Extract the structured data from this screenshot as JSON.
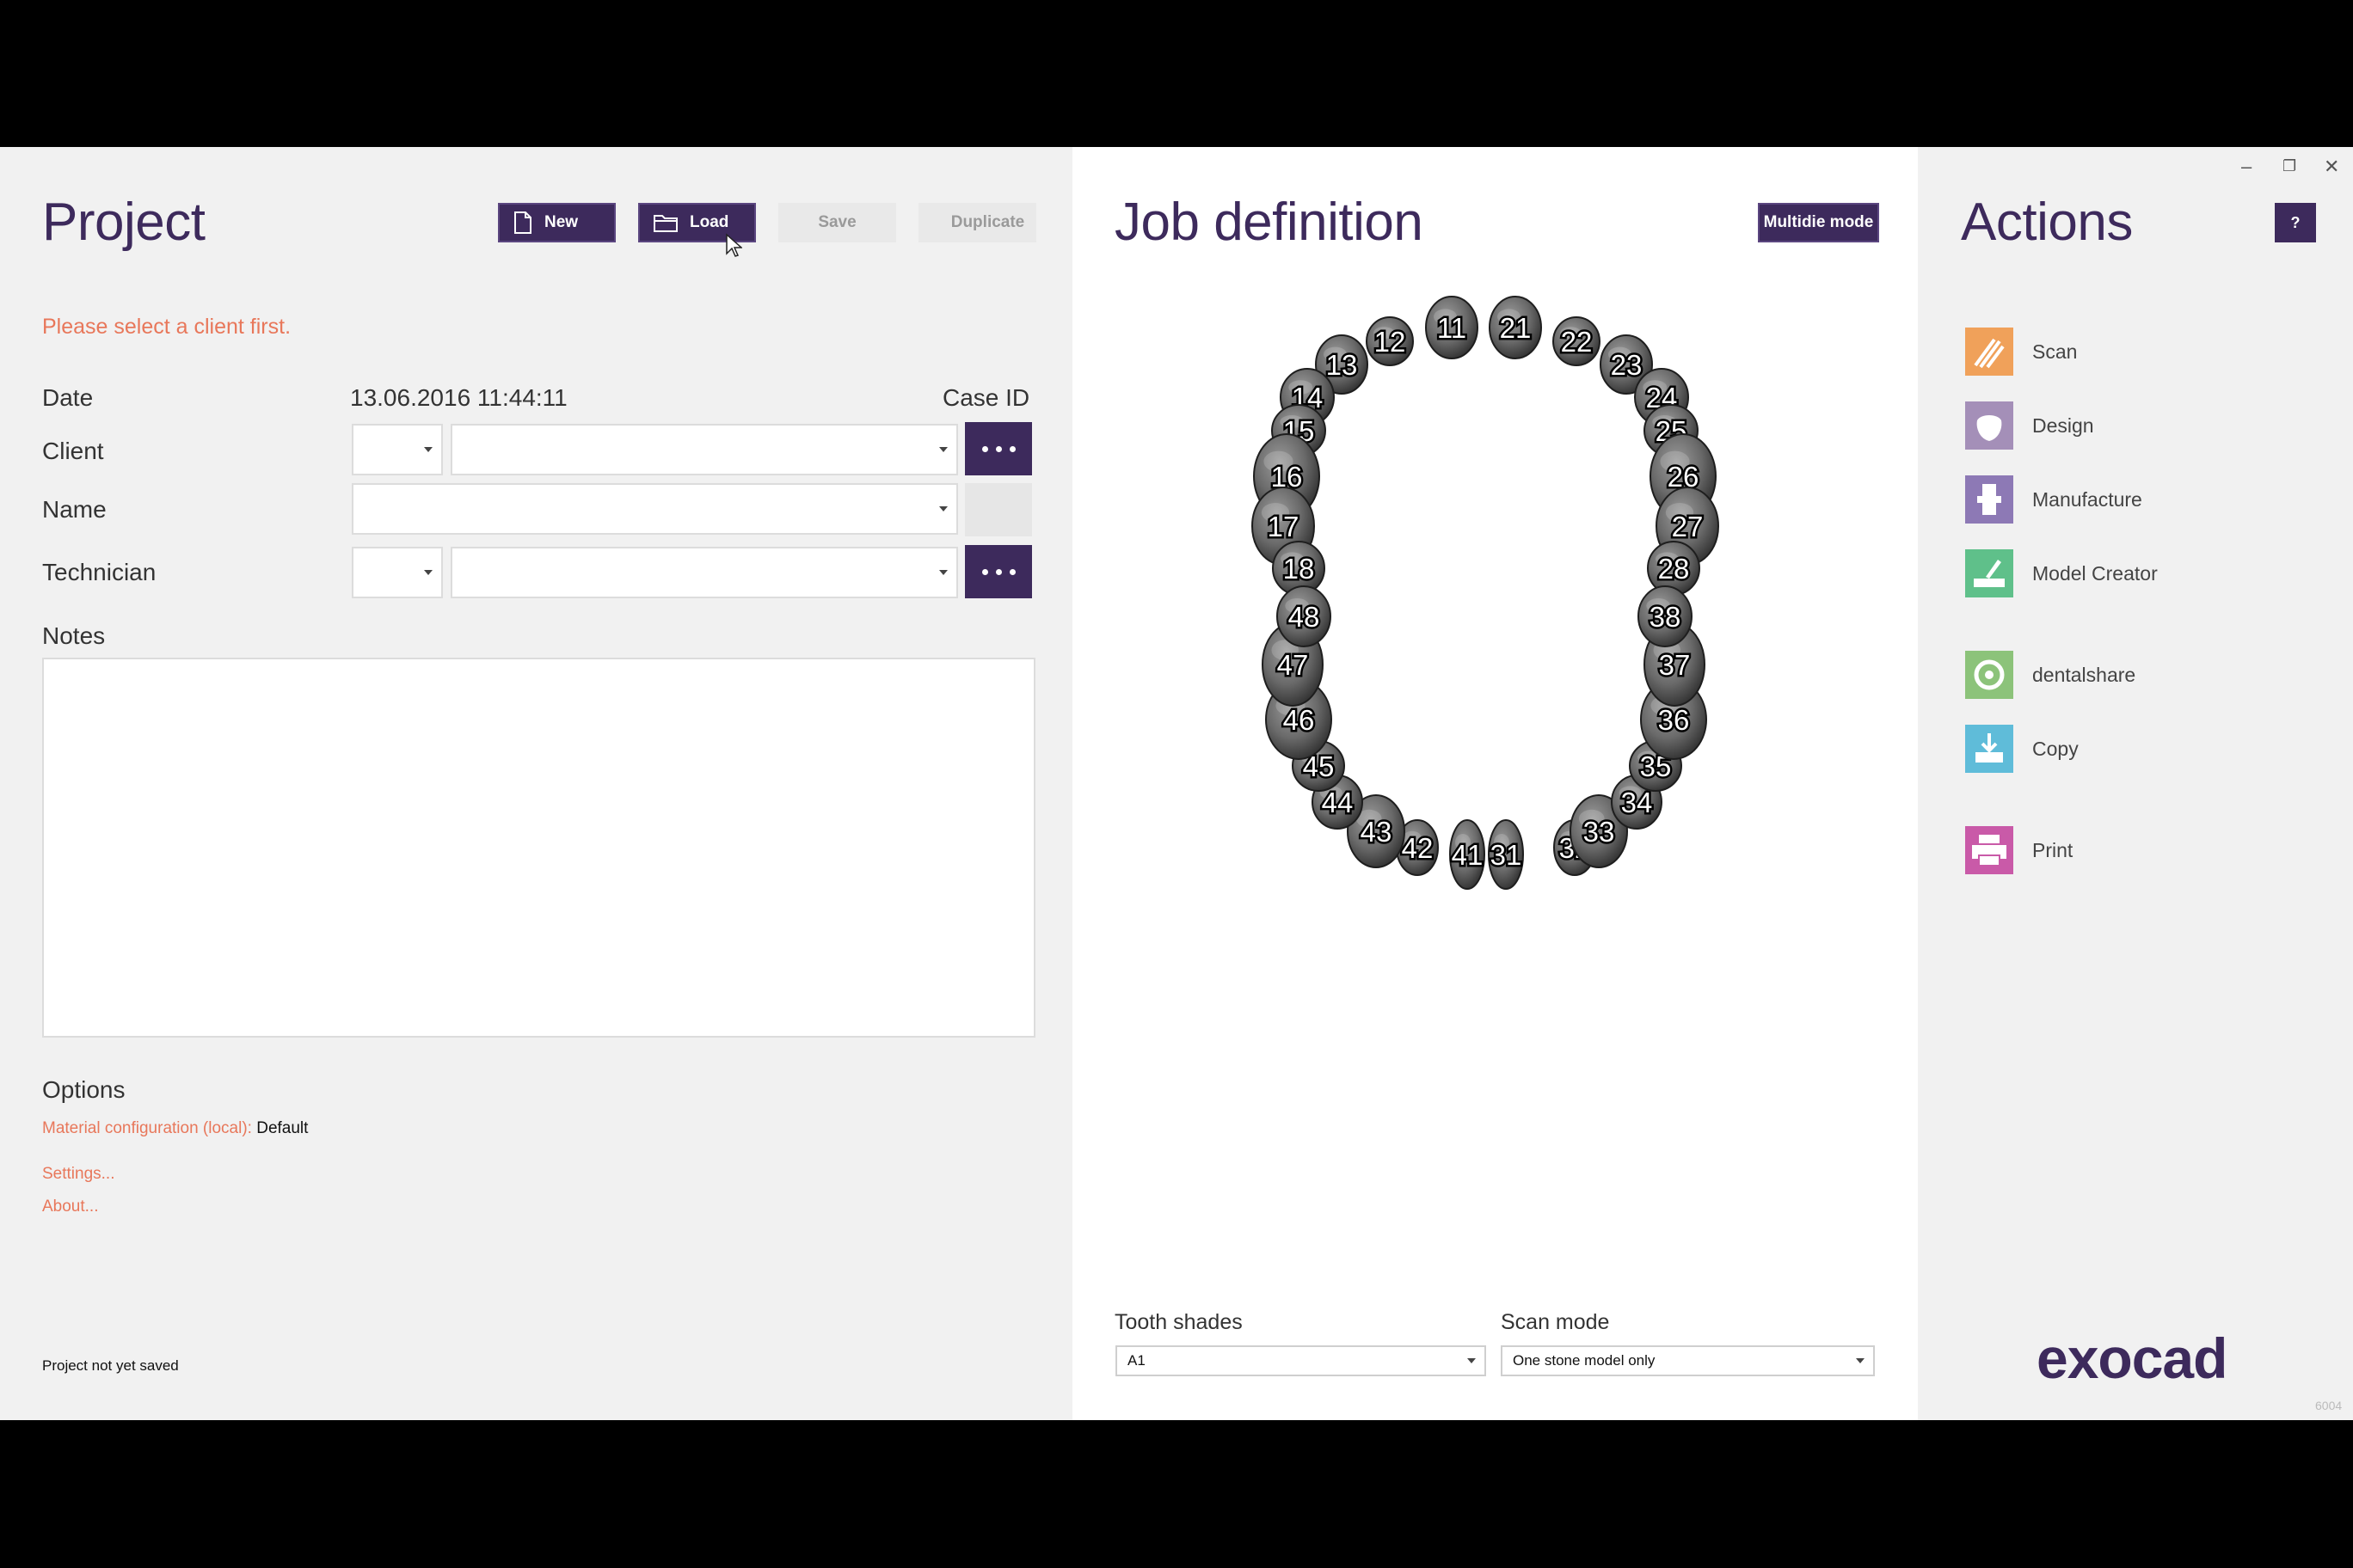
{
  "project": {
    "title": "Project",
    "buttons": {
      "new": "New",
      "load": "Load",
      "save": "Save",
      "duplicate": "Duplicate"
    },
    "warning": "Please select a client first.",
    "date_label": "Date",
    "date_value": "13.06.2016  11:44:11",
    "case_id_label": "Case ID",
    "client_label": "Client",
    "name_label": "Name",
    "technician_label": "Technician",
    "notes_label": "Notes",
    "options_label": "Options",
    "material_label": "Material configuration (local):",
    "material_value": "Default",
    "settings_link": "Settings...",
    "about_link": "About...",
    "status": "Project not yet saved"
  },
  "job": {
    "title": "Job definition",
    "multidie_button": "Multidie mode",
    "tooth_shades_label": "Tooth shades",
    "tooth_shades_value": "A1",
    "scan_mode_label": "Scan mode",
    "scan_mode_value": "One stone model only",
    "teeth": [
      "11",
      "12",
      "13",
      "14",
      "15",
      "16",
      "17",
      "18",
      "21",
      "22",
      "23",
      "24",
      "25",
      "26",
      "27",
      "28",
      "31",
      "32",
      "33",
      "34",
      "35",
      "36",
      "37",
      "38",
      "41",
      "42",
      "43",
      "44",
      "45",
      "46",
      "47",
      "48"
    ]
  },
  "actions": {
    "title": "Actions",
    "help": "?",
    "items": [
      {
        "label": "Scan",
        "icon": "scan-icon",
        "color": "#f0a15a"
      },
      {
        "label": "Design",
        "icon": "design-icon",
        "color": "#a48fb8"
      },
      {
        "label": "Manufacture",
        "icon": "manufacture-icon",
        "color": "#8d79b5"
      },
      {
        "label": "Model Creator",
        "icon": "model-creator-icon",
        "color": "#5fc08a"
      },
      {
        "label": "dentalshare",
        "icon": "dentalshare-icon",
        "color": "#8cc37a"
      },
      {
        "label": "Copy",
        "icon": "copy-icon",
        "color": "#5fbcd9"
      },
      {
        "label": "Print",
        "icon": "print-icon",
        "color": "#c95aa8"
      }
    ],
    "brand": "exocad",
    "corner_code": "6004"
  }
}
